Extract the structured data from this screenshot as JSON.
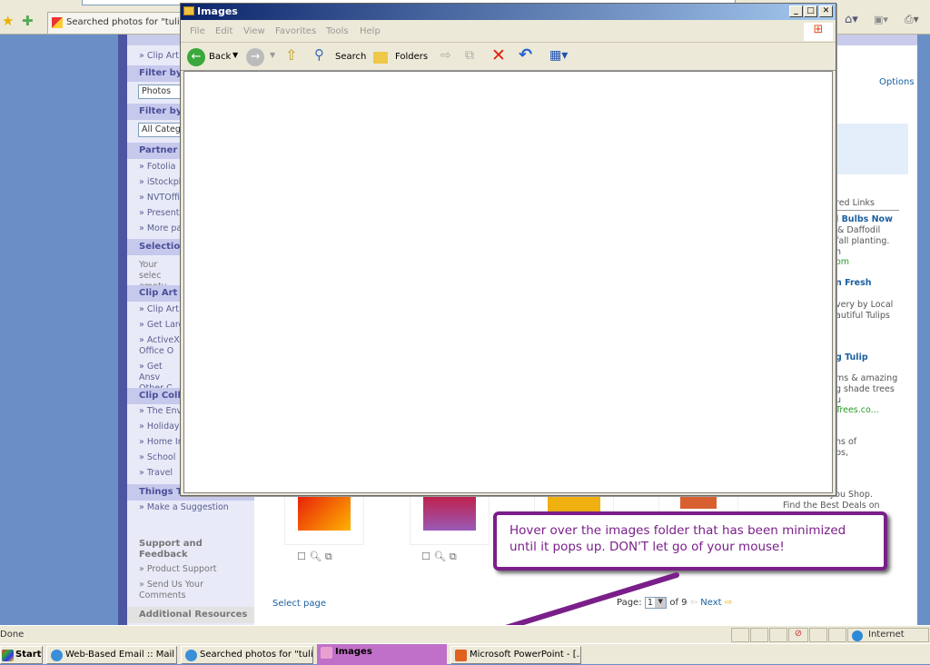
{
  "browser": {
    "tab_title": "Searched photos for \"tulip\" -",
    "status": "Done",
    "zone": "Internet"
  },
  "sidebar": {
    "top_link": "» Clip Art -",
    "filter1": {
      "title": "Filter by",
      "value": "Photos"
    },
    "filter2": {
      "title": "Filter by",
      "value": "All Categ"
    },
    "partner": {
      "title": "Partner s",
      "items": [
        "» Fotolia",
        "» iStockph",
        "» NVTOffic",
        "» Presenta",
        "» More pa"
      ]
    },
    "selection": {
      "title": "Selection",
      "text": "Your selec empty."
    },
    "clipart": {
      "title": "Clip Art F",
      "items": [
        "» Clip Art T",
        "» Get Larg",
        "» ActiveX Office O",
        "» Get Ansv Other C"
      ]
    },
    "collections": {
      "title": "Clip Colle",
      "items": [
        "» The Env",
        "» Holidays",
        "» Home Im",
        "» School",
        "» Travel"
      ]
    },
    "things": {
      "title": "Things T",
      "items": [
        "» Make a Suggestion"
      ]
    },
    "support": {
      "title": "Support and Feedback",
      "items": [
        "» Product Support",
        "» Send Us Your Comments"
      ]
    },
    "additional": "Additional Resources"
  },
  "main": {
    "options": "Options",
    "select_page": "Select page",
    "page_label": "Page:",
    "page_value": "1",
    "page_of": "of 9",
    "next": "Next"
  },
  "right": {
    "lines": [
      "red Links",
      "l Bulbs Now",
      "& Daffodil",
      "fall planting.",
      "n",
      "om",
      "n Fresh",
      "very by Local",
      "autiful Tulips",
      "g Tulip",
      "ms & amazing",
      "g shade trees",
      "u",
      "Trees.co...",
      "ns of",
      "ps,",
      "le you Shop.",
      "Find the Best Deals on"
    ]
  },
  "explorer": {
    "title": "Images",
    "menu": [
      "File",
      "Edit",
      "View",
      "Favorites",
      "Tools",
      "Help"
    ],
    "back": "Back",
    "search": "Search",
    "folders": "Folders"
  },
  "taskbar": {
    "start": "Start",
    "items": [
      "Web-Based Email :: Mail ...",
      "Searched photos for \"tuli...",
      "Images",
      "Microsoft PowerPoint - [..."
    ]
  },
  "callout": {
    "text": "Hover over the images folder that has been minimized until it pops up.  DON'T let go of your mouse!",
    "color": "#7a1f8a"
  }
}
